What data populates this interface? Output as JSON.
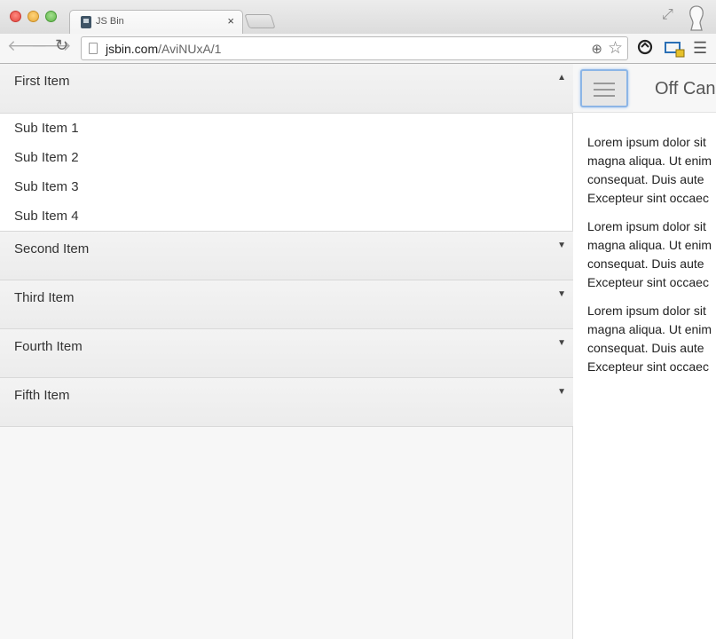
{
  "browser": {
    "tab_title": "JS Bin",
    "tab_close": "×",
    "url_host": "jsbin.com",
    "url_path": "/AviNUxA/1"
  },
  "accordion": {
    "first_item": {
      "label": "First Item",
      "expanded": true,
      "sub_items": [
        "Sub Item 1",
        "Sub Item 2",
        "Sub Item 3",
        "Sub Item 4"
      ]
    },
    "items": [
      "Second Item",
      "Third Item",
      "Fourth Item",
      "Fifth Item"
    ],
    "arrow_up": "▲",
    "arrow_down": "▼"
  },
  "main": {
    "title": "Off Can",
    "paragraphs": [
      [
        "Lorem ipsum dolor sit",
        "magna aliqua. Ut enim",
        "consequat. Duis aute",
        "Excepteur sint occaec"
      ],
      [
        "Lorem ipsum dolor sit",
        "magna aliqua. Ut enim",
        "consequat. Duis aute",
        "Excepteur sint occaec"
      ],
      [
        "Lorem ipsum dolor sit",
        "magna aliqua. Ut enim",
        "consequat. Duis aute",
        "Excepteur sint occaec"
      ]
    ]
  }
}
